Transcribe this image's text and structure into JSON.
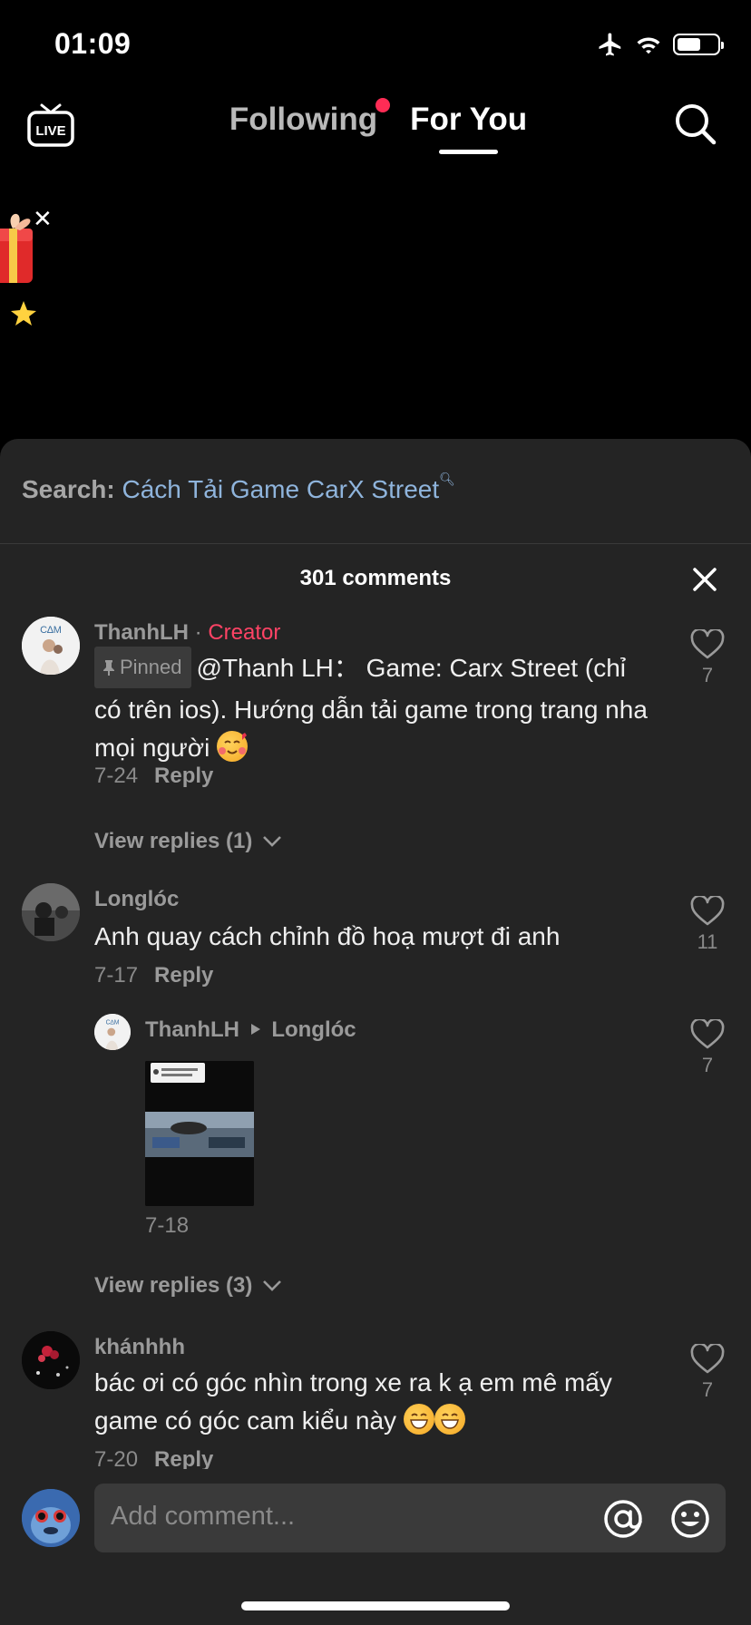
{
  "status_bar": {
    "time": "01:09",
    "icons": [
      "airplane-icon",
      "wifi-icon",
      "battery-icon"
    ],
    "battery_level": 0.6
  },
  "top_nav": {
    "live_label": "LIVE",
    "tabs": [
      {
        "label": "Following",
        "has_notification_dot": true
      },
      {
        "label": "For You",
        "active": true
      }
    ]
  },
  "sheet": {
    "search": {
      "prefix": "Search:",
      "term": "Cách Tải Game CarX Street"
    },
    "comment_count": "301 comments"
  },
  "comments": [
    {
      "user": "ThanhLH",
      "separator": " · ",
      "badge": "Creator",
      "pinned_label": "Pinned",
      "text": "@Thanh LH：  Game: Carx Street (chỉ có trên ios). Hướng dẫn tải game trong trang nha mọi người",
      "date": "7-24",
      "reply_label": "Reply",
      "likes": "7",
      "view_replies": "View replies (1)"
    },
    {
      "user": "Longlóc",
      "text": "Anh quay cách chỉnh đồ hoạ mượt đi anh",
      "date": "7-17",
      "reply_label": "Reply",
      "likes": "11",
      "reply": {
        "user": "ThanhLH",
        "to_user": "Longlóc",
        "date": "7-18",
        "likes": "7"
      },
      "view_replies": "View replies (3)"
    },
    {
      "user": "khánhhh",
      "text": "bác ơi có góc nhìn trong xe ra k ạ em mê mấy game có góc cam kiểu này",
      "date": "7-20",
      "reply_label": "Reply",
      "likes": "7"
    }
  ],
  "bottom_bar": {
    "input_placeholder": "Add comment..."
  },
  "colors": {
    "accent": "#fe2c55",
    "sheet_bg": "#242424",
    "search_link": "#8fb4dc"
  }
}
